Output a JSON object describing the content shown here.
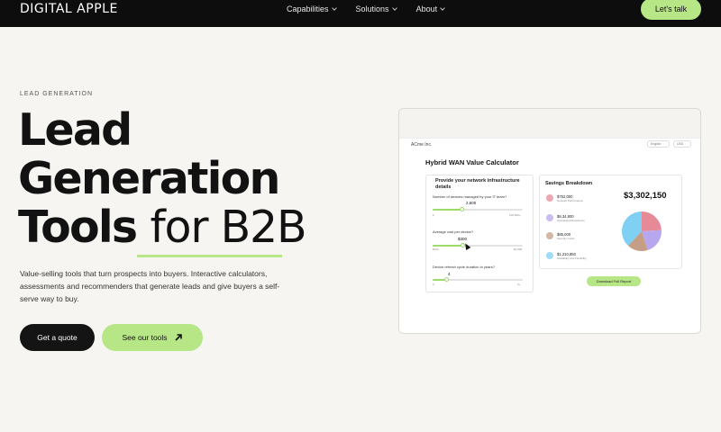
{
  "nav": {
    "logo": "DIGITAL APPLE",
    "links": [
      "Capabilities",
      "Solutions",
      "About"
    ],
    "cta": "Let's talk"
  },
  "hero": {
    "eyebrow": "LEAD GENERATION",
    "title_line1": "Lead",
    "title_line2": "Generation",
    "title_line3_bold": "Tools",
    "title_line3_light": "for B2B",
    "description": "Value-selling tools that turn prospects into buyers. Interactive calculators, assessments and recommenders that generate leads and give buyers a self-serve way to buy.",
    "primary_button": "Get a quote",
    "secondary_button": "See our tools",
    "accent_color": "#b7e686"
  },
  "mockup": {
    "company": "ACme Inc.",
    "controls": [
      "English",
      "USD"
    ],
    "title": "Hybrid WAN Value Calculator",
    "inputs_heading": "Provide your network infrastructure details",
    "inputs": [
      {
        "label": "Number of devices managed by your IT team?",
        "value": "2,500",
        "min": "0",
        "max": "100,000+",
        "fraction": 0.32
      },
      {
        "label": "Average cost per device?",
        "value": "$300",
        "min": "$100",
        "max": "$1,000",
        "fraction": 0.33
      },
      {
        "label": "Device refresh cycle duration in years?",
        "value": "4",
        "min": "0",
        "max": "5+",
        "fraction": 0.15
      }
    ],
    "savings_heading": "Savings Breakdown",
    "total": "$3,302,150",
    "savings": [
      {
        "amount": "$752,000",
        "label": "Network Performance",
        "color": "#e58a96"
      },
      {
        "amount": "$8,34,800",
        "label": "Operational Excellence",
        "color": "#b8a6ef"
      },
      {
        "amount": "$85,000",
        "label": "Security Costs",
        "color": "#c49f86"
      },
      {
        "amount": "$1,210,850",
        "label": "Scalability and Flexibility",
        "color": "#7fd0f2"
      }
    ],
    "pie_fractions": [
      0.24,
      0.21,
      0.17,
      0.38
    ],
    "download_button": "Download Full Report"
  }
}
